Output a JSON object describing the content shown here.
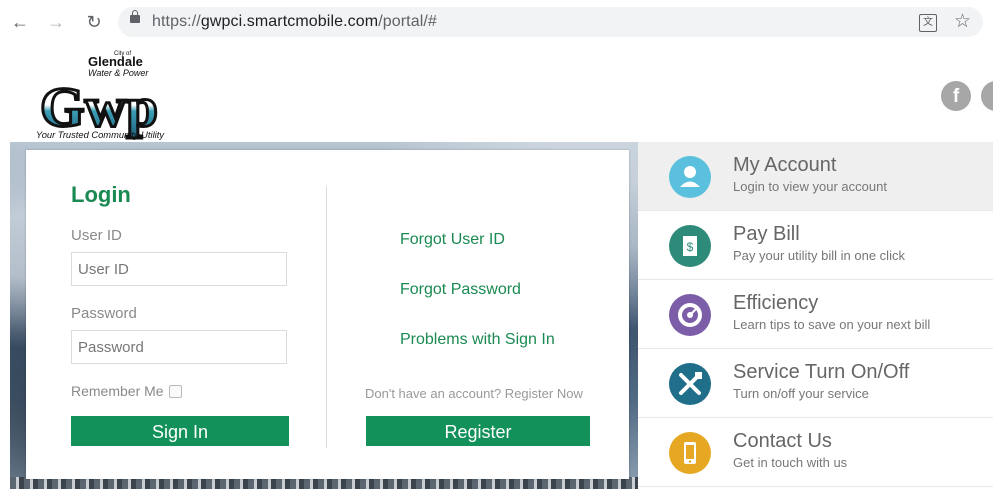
{
  "browser": {
    "url_scheme": "https://",
    "url_host": "gwpci.smartcmobile.com",
    "url_path": "/portal/#"
  },
  "logo": {
    "city": "City of",
    "name": "Glendale",
    "sub": "Water & Power",
    "letters": "Gwp",
    "tagline": "Your Trusted Community Utility"
  },
  "social": {
    "facebook": "f"
  },
  "login": {
    "title": "Login",
    "user_label": "User ID",
    "user_placeholder": "User ID",
    "password_label": "Password",
    "password_placeholder": "Password",
    "remember": "Remember Me",
    "signin": "Sign In",
    "forgot_user": "Forgot User ID",
    "forgot_password": "Forgot Password",
    "problems": "Problems with Sign In",
    "no_account": "Don't have an account? Register Now",
    "register": "Register"
  },
  "menu": {
    "items": [
      {
        "title": "My Account",
        "subtitle": "Login to view your account",
        "icon": "user-icon",
        "color": "#5bc0de"
      },
      {
        "title": "Pay Bill",
        "subtitle": "Pay your utility bill in one click",
        "icon": "dollar-bill-icon",
        "color": "#2e8b7a"
      },
      {
        "title": "Efficiency",
        "subtitle": "Learn tips to save on your next bill",
        "icon": "efficiency-icon",
        "color": "#7b5ea7"
      },
      {
        "title": "Service Turn On/Off",
        "subtitle": "Turn on/off your service",
        "icon": "tools-icon",
        "color": "#1f6f8b"
      },
      {
        "title": "Contact Us",
        "subtitle": "Get in touch with us",
        "icon": "phone-icon",
        "color": "#e6a823"
      }
    ]
  }
}
